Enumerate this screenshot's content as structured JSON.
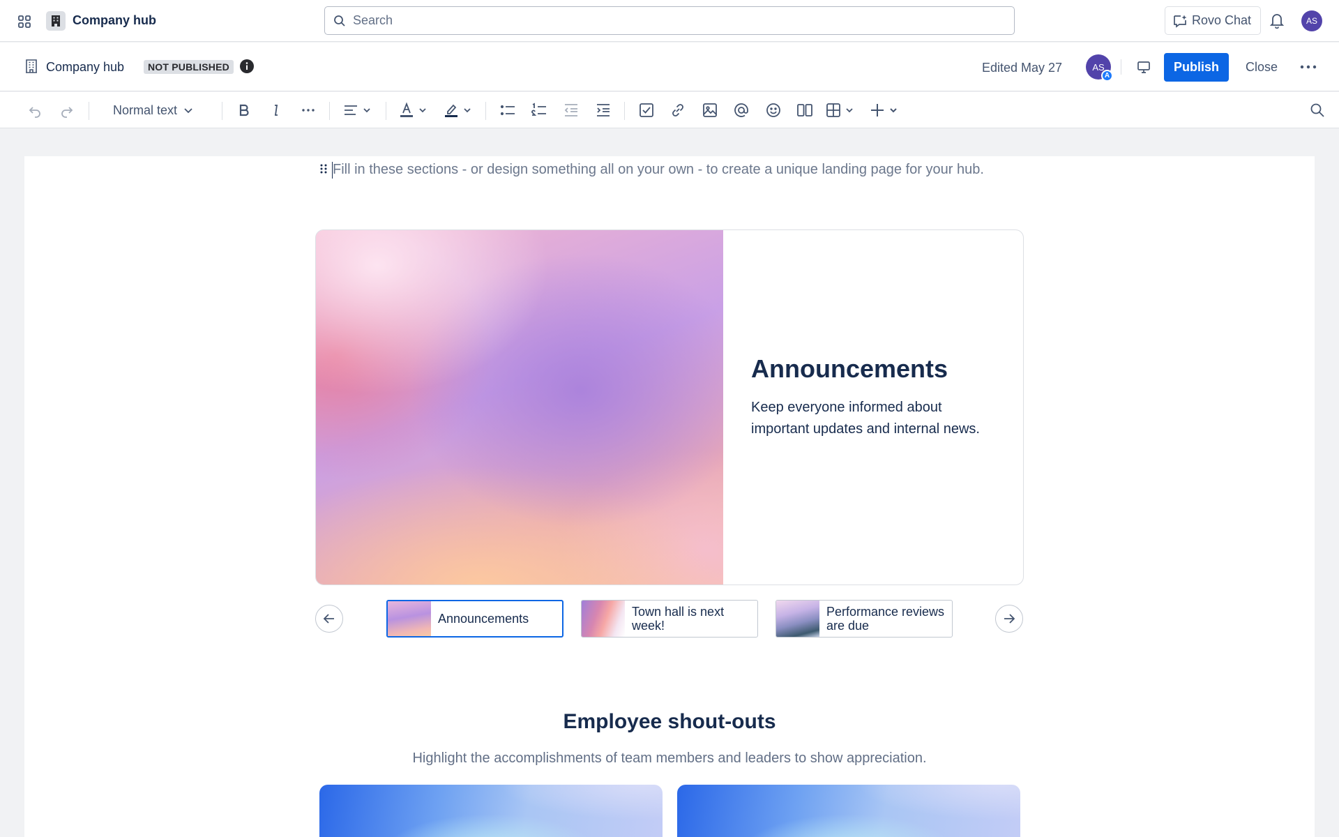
{
  "topnav": {
    "hub_name": "Company hub",
    "search_placeholder": "Search",
    "rovo_label": "Rovo Chat",
    "user_initials": "AS"
  },
  "pagebar": {
    "title": "Company hub",
    "status_badge": "NOT PUBLISHED",
    "edited": "Edited May 27",
    "collaborator_initials": "AS",
    "collaborator_badge": "A",
    "publish_label": "Publish",
    "close_label": "Close"
  },
  "toolbar": {
    "text_style": "Normal text"
  },
  "content": {
    "intro": "Fill in these sections - or design something all on your own - to create a unique landing page for your hub.",
    "hero": {
      "title": "Announcements",
      "description": "Keep everyone informed about important updates and internal news."
    },
    "carousel": [
      {
        "label": "Announcements",
        "active": true
      },
      {
        "label": "Town hall is next week!",
        "active": false
      },
      {
        "label": "Performance reviews are due",
        "active": false
      }
    ],
    "shoutouts": {
      "title": "Employee shout-outs",
      "subtitle": "Highlight the accomplishments of team members and leaders to show appreciation."
    }
  },
  "colors": {
    "primary": "#0c66e4",
    "avatar": "#5243aa",
    "text": "#172b4d",
    "subtle_text": "#626f86"
  }
}
